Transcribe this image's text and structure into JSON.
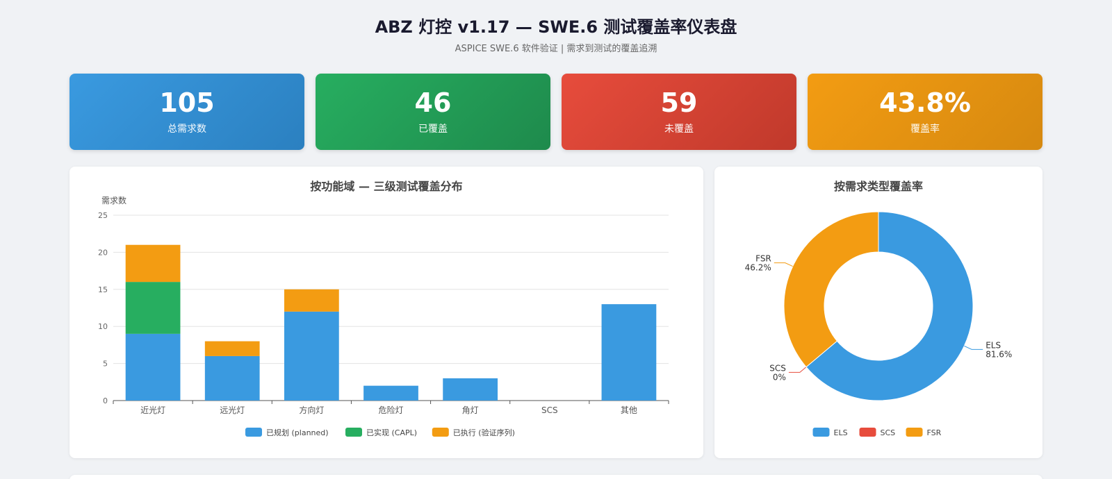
{
  "header": {
    "title": "ABZ 灯控 v1.17 — SWE.6 测试覆盖率仪表盘",
    "subtitle": "ASPICE SWE.6 软件验证 | 需求到测试的覆盖追溯"
  },
  "stats": [
    {
      "value": "105",
      "label": "总需求数"
    },
    {
      "value": "46",
      "label": "已覆盖"
    },
    {
      "value": "59",
      "label": "未覆盖"
    },
    {
      "value": "43.8%",
      "label": "覆盖率"
    }
  ],
  "chart_data": [
    {
      "type": "bar",
      "stacked": true,
      "title": "按功能域 — 三级测试覆盖分布",
      "ylabel": "需求数",
      "xlabel": "",
      "ylim": [
        0,
        25
      ],
      "yticks": [
        0,
        5,
        10,
        15,
        20,
        25
      ],
      "grid": true,
      "legend": "bottom",
      "categories": [
        "近光灯",
        "远光灯",
        "方向灯",
        "危险灯",
        "角灯",
        "SCS",
        "其他"
      ],
      "series": [
        {
          "name": "已规划 (planned)",
          "color": "#3a9ae0",
          "values": [
            9,
            6,
            12,
            2,
            3,
            0,
            13
          ]
        },
        {
          "name": "已实现 (CAPL)",
          "color": "#27ae60",
          "values": [
            7,
            0,
            0,
            0,
            0,
            0,
            0
          ]
        },
        {
          "name": "已执行 (验证序列)",
          "color": "#f39c12",
          "values": [
            5,
            2,
            3,
            0,
            0,
            0,
            0
          ]
        }
      ]
    },
    {
      "type": "pie",
      "donut": true,
      "title": "按需求类型覆盖率",
      "legend": "bottom",
      "slices": [
        {
          "name": "ELS",
          "value": 81.6,
          "label": "81.6%",
          "color": "#3a9ae0"
        },
        {
          "name": "SCS",
          "value": 0,
          "label": "0%",
          "color": "#e74c3c"
        },
        {
          "name": "FSR",
          "value": 46.2,
          "label": "46.2%",
          "color": "#f39c12"
        }
      ]
    }
  ]
}
